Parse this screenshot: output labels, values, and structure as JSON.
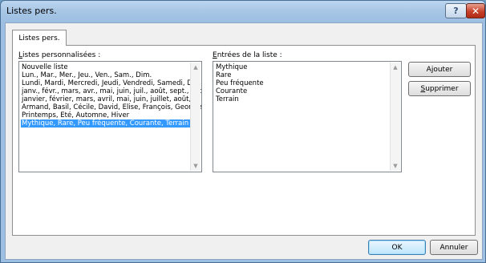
{
  "window": {
    "title": "Listes pers.",
    "help_glyph": "?",
    "close_glyph": "✕"
  },
  "tab": {
    "label": "Listes pers."
  },
  "custom_lists": {
    "label_mnemonic": "L",
    "label_rest": "istes personnalisées :",
    "items": [
      "Nouvelle liste",
      "Lun., Mar., Mer., Jeu., Ven., Sam., Dim.",
      "Lundi, Mardi, Mercredi, Jeudi, Vendredi, Samedi, Dima",
      "janv., févr., mars, avr., mai, juin, juil., août, sept., oct",
      "janvier, février, mars, avril, mai, juin, juillet, août, sep",
      "Armand, Basil, Cécile, David, Elise, François, Georges",
      "Printemps, Eté, Automne, Hiver",
      "Mythique, Rare, Peu fréquente, Courante, Terrain"
    ],
    "selected_index": 7
  },
  "entries": {
    "label_mnemonic": "E",
    "label_rest": "ntrées de la liste :",
    "items": [
      "Mythique",
      "Rare",
      "Peu fréquente",
      "Courante",
      "Terrain"
    ]
  },
  "buttons": {
    "add_pre": "A",
    "add_mnemonic": "j",
    "add_post": "outer",
    "delete_mnemonic": "S",
    "delete_rest": "upprimer",
    "ok": "OK",
    "cancel": "Annuler"
  },
  "icons": {
    "scroll_up": "▲",
    "scroll_down": "▼"
  }
}
